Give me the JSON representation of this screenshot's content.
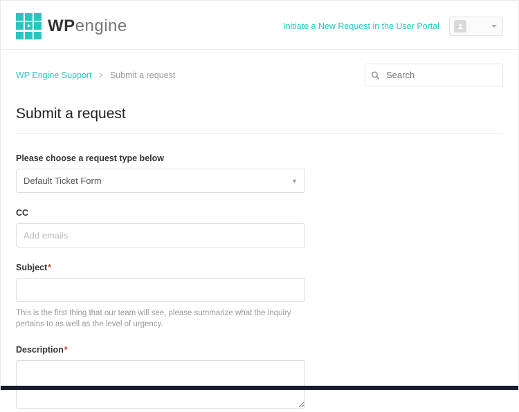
{
  "header": {
    "logo_wp": "WP",
    "logo_engine": "engine",
    "portal_link": "Initiate a New Request in the User Portal"
  },
  "breadcrumb": {
    "root": "WP Engine Support",
    "separator": ">",
    "current": "Submit a request"
  },
  "search": {
    "placeholder": "Search"
  },
  "page": {
    "title": "Submit a request"
  },
  "form": {
    "request_type": {
      "label": "Please choose a request type below",
      "selected": "Default Ticket Form"
    },
    "cc": {
      "label": "CC",
      "placeholder": "Add emails"
    },
    "subject": {
      "label": "Subject",
      "hint": "This is the first thing that our team will see, please summarize what the inquiry pertains to as well as the level of urgency."
    },
    "description": {
      "label": "Description"
    }
  }
}
